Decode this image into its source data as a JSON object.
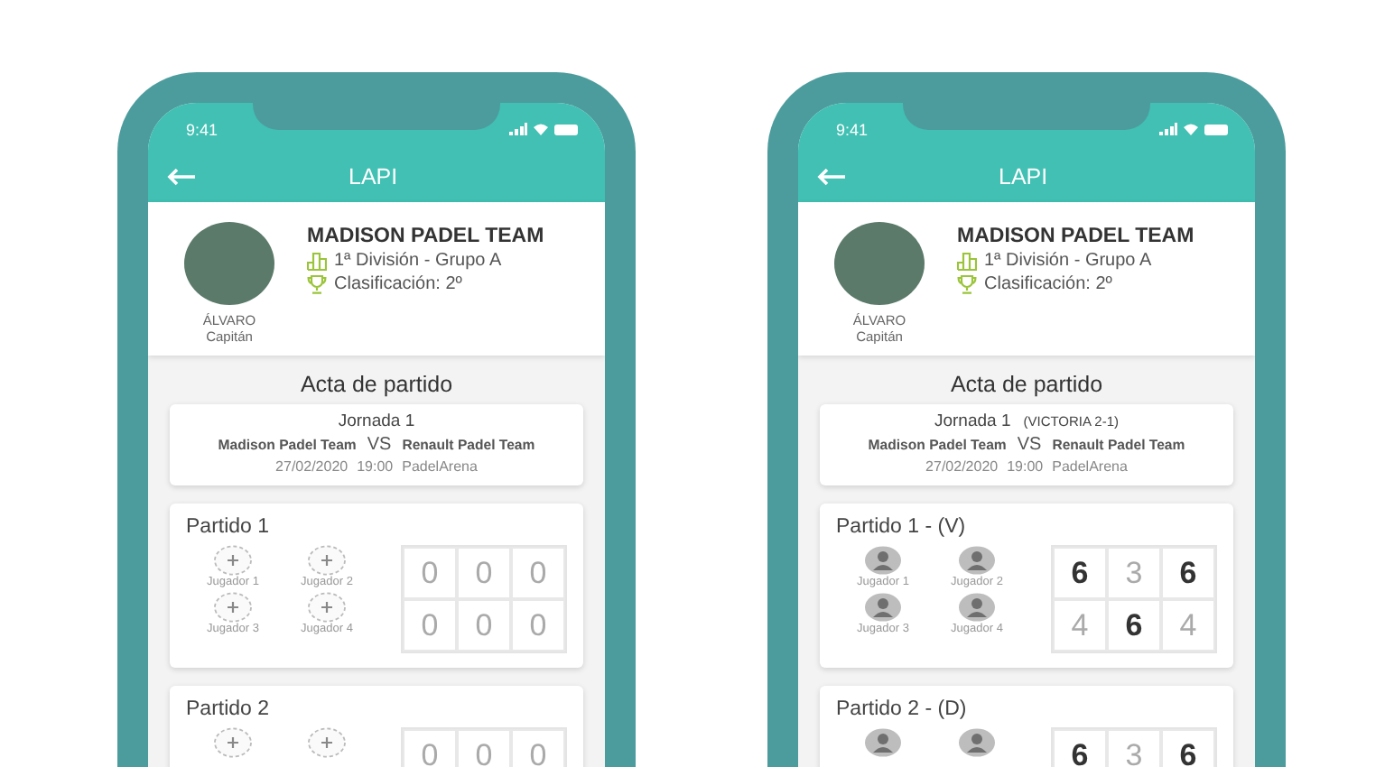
{
  "phones": [
    {
      "status_time": "9:41",
      "title": "LAPI",
      "team": {
        "player_name": "ÁLVARO",
        "player_role": "Capitán",
        "team_name": "MADISON PADEL TEAM",
        "division": "1ª División - Grupo A",
        "ranking": "Clasificación: 2º"
      },
      "section_title": "Acta de partido",
      "fixture": {
        "round": "Jornada 1",
        "home": "Madison Padel Team",
        "vs": "VS",
        "away": "Renault Padel Team",
        "date": "27/02/2020",
        "time": "19:00",
        "venue": "PadelArena"
      },
      "matches": [
        {
          "title": "Partido 1",
          "players": [
            {
              "kind": "empty",
              "label": "Jugador 1"
            },
            {
              "kind": "empty",
              "label": "Jugador 2"
            },
            {
              "kind": "empty",
              "label": "Jugador 3"
            },
            {
              "kind": "empty",
              "label": "Jugador 4"
            }
          ],
          "scores": [
            [
              {
                "value": "0",
                "won": false
              },
              {
                "value": "0",
                "won": false
              },
              {
                "value": "0",
                "won": false
              }
            ],
            [
              {
                "value": "0",
                "won": false
              },
              {
                "value": "0",
                "won": false
              },
              {
                "value": "0",
                "won": false
              }
            ]
          ]
        },
        {
          "title": "Partido 2",
          "players": [
            {
              "kind": "empty"
            },
            {
              "kind": "empty"
            }
          ],
          "scores": [
            [
              {
                "value": "0",
                "won": false
              },
              {
                "value": "0",
                "won": false
              },
              {
                "value": "0",
                "won": false
              }
            ]
          ]
        }
      ]
    },
    {
      "status_time": "9:41",
      "title": "LAPI",
      "team": {
        "player_name": "ÁLVARO",
        "player_role": "Capitán",
        "team_name": "MADISON PADEL TEAM",
        "division": "1ª División - Grupo A",
        "ranking": "Clasificación: 2º"
      },
      "section_title": "Acta de partido",
      "fixture": {
        "round": "Jornada 1",
        "result": "(VICTORIA 2-1)",
        "home": "Madison Padel Team",
        "vs": "VS",
        "away": "Renault Padel Team",
        "date": "27/02/2020",
        "time": "19:00",
        "venue": "PadelArena"
      },
      "matches": [
        {
          "title": "Partido 1 - (V)",
          "players": [
            {
              "kind": "assigned",
              "label": "Jugador 1"
            },
            {
              "kind": "assigned",
              "label": "Jugador 2"
            },
            {
              "kind": "assigned",
              "label": "Jugador 3"
            },
            {
              "kind": "assigned",
              "label": "Jugador 4"
            }
          ],
          "scores": [
            [
              {
                "value": "6",
                "won": true
              },
              {
                "value": "3",
                "won": false
              },
              {
                "value": "6",
                "won": true
              }
            ],
            [
              {
                "value": "4",
                "won": false
              },
              {
                "value": "6",
                "won": true
              },
              {
                "value": "4",
                "won": false
              }
            ]
          ]
        },
        {
          "title": "Partido 2 - (D)",
          "players": [
            {
              "kind": "assigned"
            },
            {
              "kind": "assigned"
            }
          ],
          "scores": [
            [
              {
                "value": "6",
                "won": true
              },
              {
                "value": "3",
                "won": false
              },
              {
                "value": "6",
                "won": true
              }
            ]
          ]
        }
      ]
    }
  ]
}
